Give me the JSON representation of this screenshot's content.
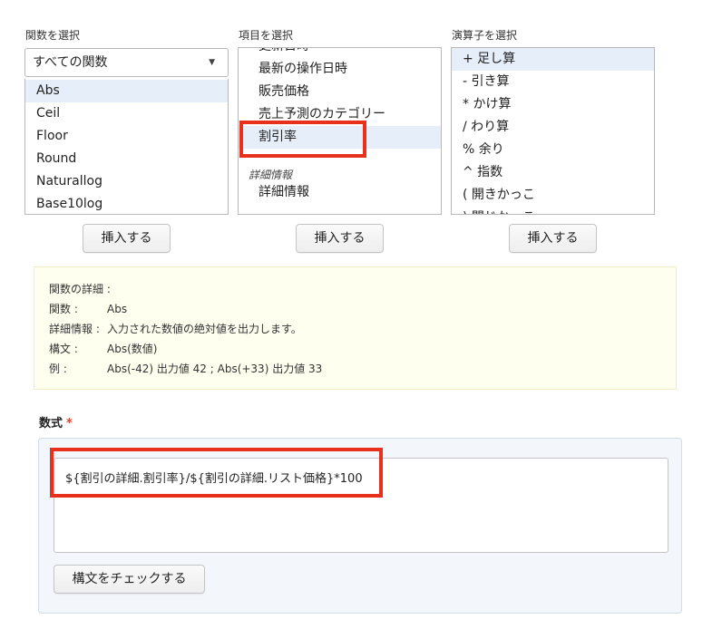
{
  "functions": {
    "label": "関数を選択",
    "select_value": "すべての関数",
    "items": [
      "Abs",
      "Ceil",
      "Floor",
      "Round",
      "Naturallog",
      "Base10log"
    ],
    "insert_button": "挿入する"
  },
  "fields": {
    "label": "項目を選択",
    "items_top": [
      "更新日時",
      "最新の操作日時",
      "販売価格",
      "売上予測のカテゴリー",
      "割引率"
    ],
    "group_label": "詳細情報",
    "group_items": [
      "詳細情報"
    ],
    "insert_button": "挿入する"
  },
  "operators": {
    "label": "演算子を選択",
    "items": [
      "+ 足し算",
      "- 引き算",
      "* かけ算",
      "/ わり算",
      "% 余り",
      "^ 指数",
      "( 開きかっこ",
      ") 閉じかっこ"
    ],
    "insert_button": "挿入する"
  },
  "details": {
    "heading": "関数の詳細 :",
    "function_label": "関数 :",
    "function_value": "Abs",
    "info_label": "詳細情報 :",
    "info_value": "入力された数値の絶対値を出力します。",
    "syntax_label": "構文 :",
    "syntax_value": "Abs(数値)",
    "example_label": "例 :",
    "example_value": "Abs(-42) 出力値 42 ; Abs(+33) 出力値 33"
  },
  "formula": {
    "label": "数式",
    "required_mark": "*",
    "value": "${割引の詳細.割引率}/${割引の詳細.リスト価格}*100",
    "check_button": "構文をチェックする"
  },
  "colors": {
    "highlight": "#e8301c",
    "selected_row": "#e5eef9",
    "details_bg": "#fffff0",
    "formula_panel_bg": "#f3f6fb"
  },
  "icons": {
    "select_caret": "▼"
  }
}
